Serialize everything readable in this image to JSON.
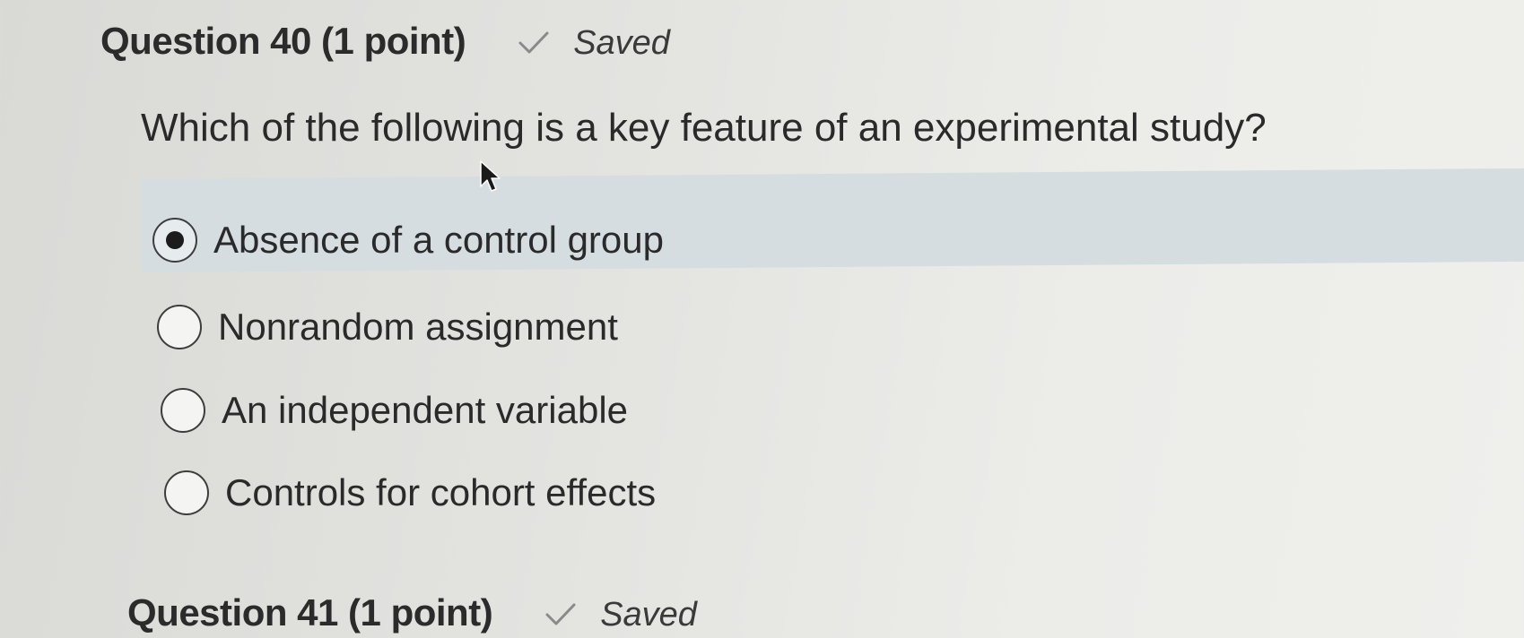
{
  "questions": [
    {
      "title": "Question 40 (1 point)",
      "status": "Saved",
      "prompt": "Which of the following is a key feature of an experimental study?",
      "options": [
        {
          "label": "Absence of a control group",
          "selected": true
        },
        {
          "label": "Nonrandom assignment",
          "selected": false
        },
        {
          "label": "An independent variable",
          "selected": false
        },
        {
          "label": "Controls for cohort effects",
          "selected": false
        }
      ]
    },
    {
      "title": "Question 41 (1 point)",
      "status": "Saved"
    }
  ],
  "icons": {
    "status_icon": "checkmark-icon",
    "pointer": "mouse-cursor-icon"
  },
  "colors": {
    "selected_background": "#d5dde0",
    "text": "#2a2a2a"
  }
}
